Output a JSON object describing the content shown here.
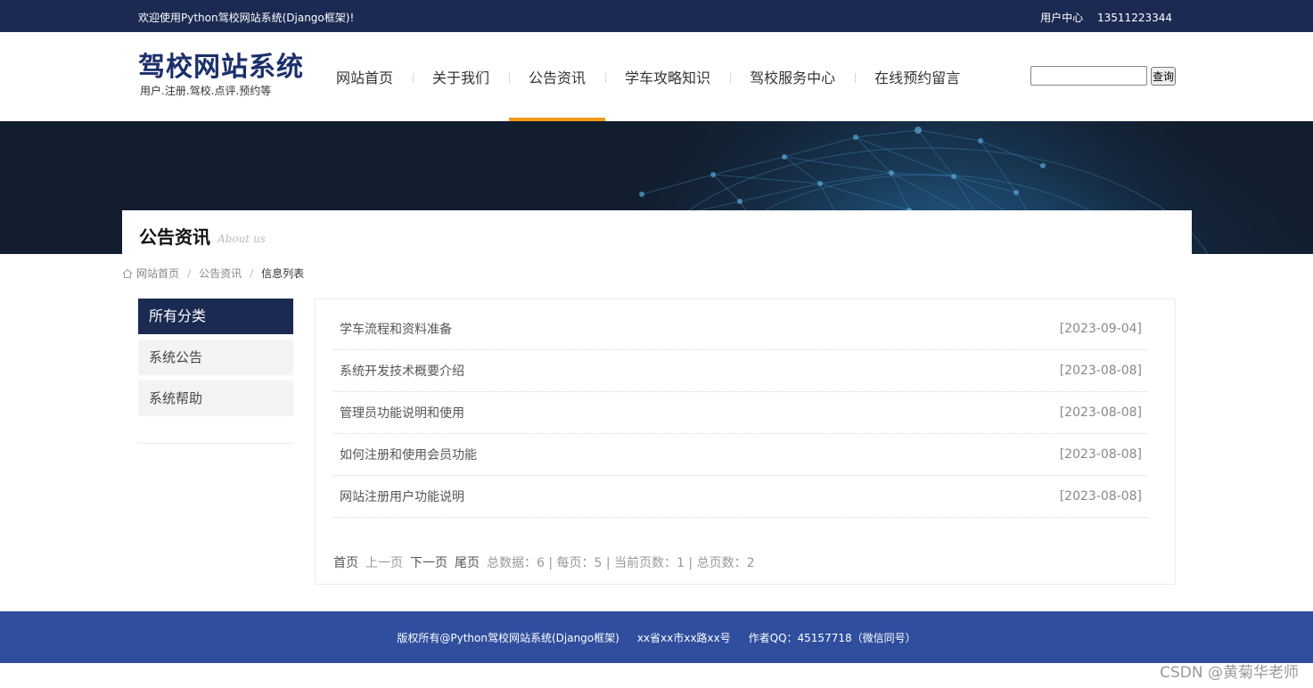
{
  "topbar": {
    "welcome": "欢迎使用Python驾校网站系统(Django框架)!",
    "user_center": "用户中心",
    "phone": "13511223344"
  },
  "header": {
    "site_name": "驾校网站系统",
    "tagline": "用户.注册.驾校.点评.预约等"
  },
  "nav": [
    {
      "label": "网站首页"
    },
    {
      "label": "关于我们"
    },
    {
      "label": "公告资讯"
    },
    {
      "label": "学车攻略知识"
    },
    {
      "label": "驾校服务中心"
    },
    {
      "label": "在线预约留言"
    }
  ],
  "search": {
    "value": "",
    "button_label": "查询"
  },
  "banner": {
    "title": "公告资讯",
    "subtitle": "About us"
  },
  "breadcrumb": {
    "home": "网站首页",
    "section": "公告资讯",
    "current": "信息列表",
    "separator": "/"
  },
  "sidebar": {
    "heading": "所有分类",
    "items": [
      {
        "label": "系统公告"
      },
      {
        "label": "系统帮助"
      }
    ]
  },
  "news": [
    {
      "title": "学车流程和资料准备",
      "date": "[2023-09-04]"
    },
    {
      "title": "系统开发技术概要介绍",
      "date": "[2023-08-08]"
    },
    {
      "title": "管理员功能说明和使用",
      "date": "[2023-08-08]"
    },
    {
      "title": "如何注册和使用会员功能",
      "date": "[2023-08-08]"
    },
    {
      "title": "网站注册用户功能说明",
      "date": "[2023-08-08]"
    }
  ],
  "pager": {
    "first": "首页",
    "prev": "上一页",
    "next": "下一页",
    "last": "尾页",
    "info": "总数据：6 | 每页：5 | 当前页数：1 | 总页数：2"
  },
  "footer": {
    "copyright": "版权所有@Python驾校网站系统(Django框架)",
    "address": "xx省xx市xx路xx号",
    "author": "作者QQ：45157718（微信同号）"
  },
  "watermark": "CSDN @黄菊华老师",
  "colors": {
    "topbar": "#1b2a52",
    "nav_active": "#f39a12",
    "footer": "#2f4e9e",
    "logo": "#1b2f6b"
  }
}
